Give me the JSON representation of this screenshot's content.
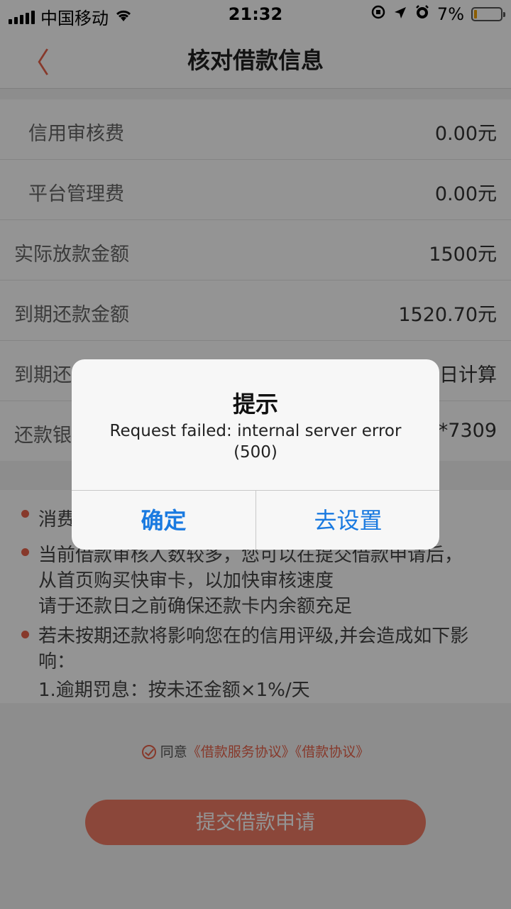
{
  "status_bar": {
    "carrier": "中国移动",
    "time": "21:32",
    "battery": "7%"
  },
  "nav": {
    "back_symbol": "〈",
    "title": "核对借款信息"
  },
  "rows": [
    {
      "label": "信用审核费",
      "value": "0.00元"
    },
    {
      "label": "平台管理费",
      "value": "0.00元"
    },
    {
      "label": "实际放款金额",
      "value": "1500元"
    },
    {
      "label": "到期还款金额",
      "value": "1520.70元"
    },
    {
      "label": "到期还",
      "value": "日计算"
    },
    {
      "label": "还款银",
      "value": "*7309"
    }
  ],
  "notes": {
    "n1": "消费",
    "n2a": "当前借款审核人数较多，您可以在提交借款申请后，",
    "n2b": "从首页购买快审卡，以加快审核速度",
    "n2c": "请于还款日之前确保还款卡内余额充足",
    "n3a": "若未按期还款将影响您在的信用评级,并会造成如下影",
    "n3b": "响：",
    "n3c": "1.逾期罚息：按未还金额×1%/天"
  },
  "agreement": {
    "prefix": "同意",
    "link1": "《借款服务协议》",
    "link2": "《借款协议》"
  },
  "submit_label": "提交借款申请",
  "dialog": {
    "title": "提示",
    "message": "Request failed: internal server error (500)",
    "ok_label": "确定",
    "settings_label": "去设置"
  },
  "colors": {
    "accent": "#e8634a",
    "dialog_button": "#1a7ae0"
  }
}
